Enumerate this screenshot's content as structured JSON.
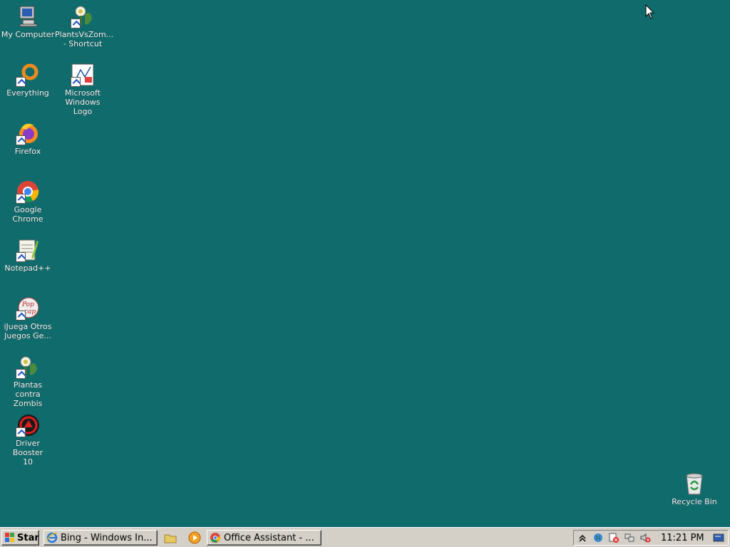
{
  "desktop": {
    "icons": [
      {
        "label": "My Computer"
      },
      {
        "label": "PlantsVsZom...\n- Shortcut"
      },
      {
        "label": "Everything"
      },
      {
        "label": "Microsoft\nWindows Logo"
      },
      {
        "label": "Firefox"
      },
      {
        "label": "Google Chrome"
      },
      {
        "label": "Notepad++"
      },
      {
        "label": "iJuega Otros\nJuegos Ge..."
      },
      {
        "label": "Plantas contra\nZombis"
      },
      {
        "label": "Driver Booster\n10"
      },
      {
        "label": "Recycle Bin"
      }
    ],
    "background_color": "#106c6c"
  },
  "taskbar": {
    "start_label": "Start",
    "tasks": [
      {
        "label": "Bing - Windows In..."
      },
      {
        "label": "Office Assistant - ..."
      }
    ],
    "clock": "11:21 PM"
  }
}
